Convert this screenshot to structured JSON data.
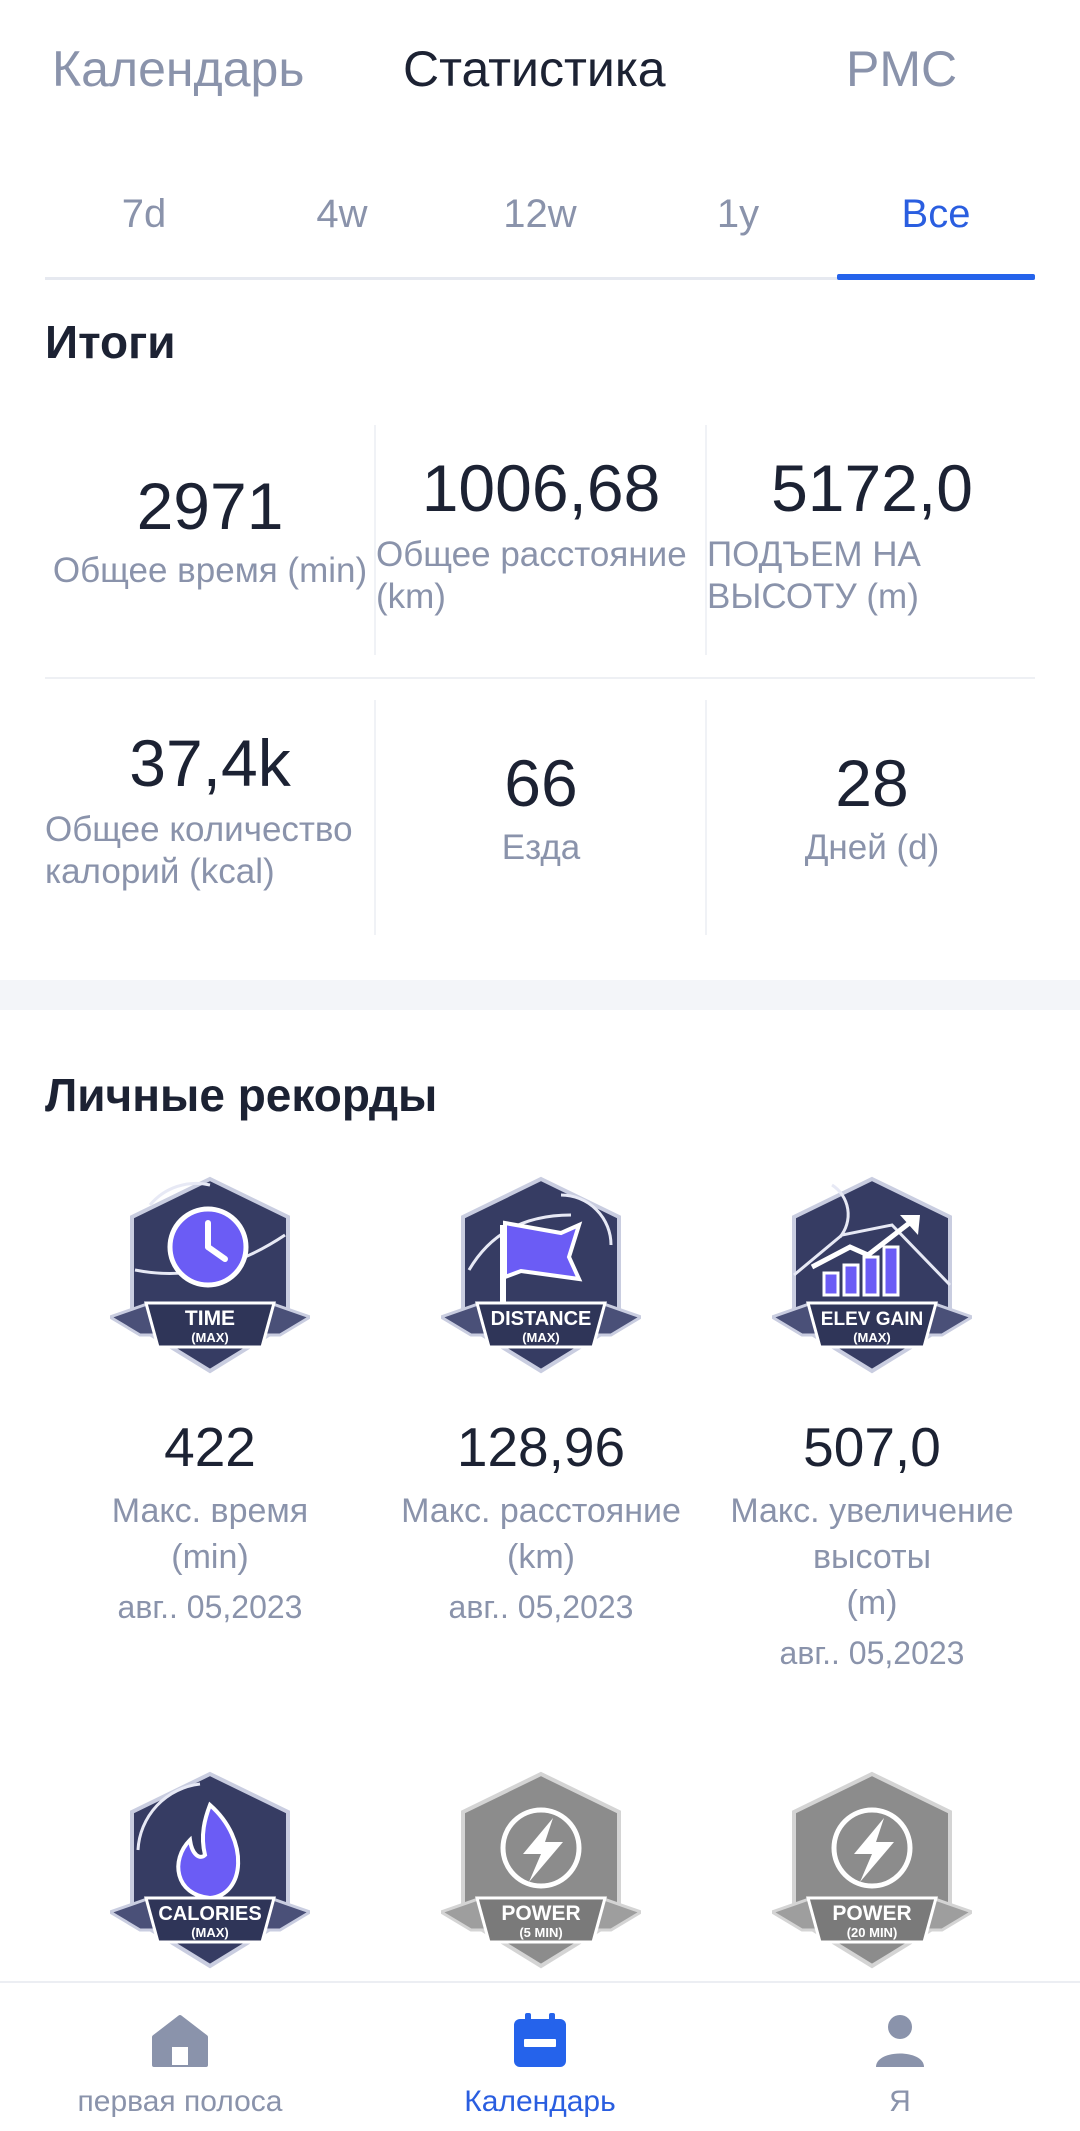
{
  "top_tabs": [
    {
      "label": "Календарь"
    },
    {
      "label": "Статистика"
    },
    {
      "label": "PMC"
    }
  ],
  "range_tabs": [
    {
      "label": "7d"
    },
    {
      "label": "4w"
    },
    {
      "label": "12w"
    },
    {
      "label": "1y"
    },
    {
      "label": "Все"
    }
  ],
  "summary": {
    "title": "Итоги",
    "stats": [
      {
        "value": "2971",
        "label": "Общее время (min)"
      },
      {
        "value": "1006,68",
        "label": "Общее расстояние (km)"
      },
      {
        "value": "5172,0",
        "label": "ПОДЪЕМ НА ВЫСОТУ (m)"
      },
      {
        "value": "37,4k",
        "label": "Общее количество калорий (kcal)"
      },
      {
        "value": "66",
        "label": "Езда"
      },
      {
        "value": "28",
        "label": "Дней (d)"
      }
    ]
  },
  "records": {
    "title": "Личные рекорды",
    "items": [
      {
        "badge_title": "TIME",
        "badge_sub": "(MAX)",
        "icon": "clock-icon",
        "value": "422",
        "label_line1": "Макс. время",
        "label_line2": "(min)",
        "date": "авг.. 05,2023"
      },
      {
        "badge_title": "DISTANCE",
        "badge_sub": "(MAX)",
        "icon": "flag-icon",
        "value": "128,96",
        "label_line1": "Макс. расстояние",
        "label_line2": "(km)",
        "date": "авг.. 05,2023"
      },
      {
        "badge_title": "ELEV GAIN",
        "badge_sub": "(MAX)",
        "icon": "elevation-chart-icon",
        "value": "507,0",
        "label_line1": "Макс. увеличение",
        "label_line2": "высоты",
        "label_line3": "(m)",
        "date": "авг.. 05,2023"
      },
      {
        "badge_title": "CALORIES",
        "badge_sub": "(MAX)",
        "icon": "flame-icon"
      },
      {
        "badge_title": "POWER",
        "badge_sub": "(5 MIN)",
        "icon": "lightning-icon"
      },
      {
        "badge_title": "POWER",
        "badge_sub": "(20 MIN)",
        "icon": "lightning-icon"
      }
    ]
  },
  "bottom_nav": [
    {
      "label": "первая полоса",
      "icon": "home-icon"
    },
    {
      "label": "Календарь",
      "icon": "calendar-icon"
    },
    {
      "label": "Я",
      "icon": "profile-icon"
    }
  ],
  "colors": {
    "accent": "#2563eb",
    "text": "#1c2233",
    "muted": "#8a93ab",
    "badge_dark": "#363c63",
    "badge_purple": "#6b5cf5",
    "badge_gray": "#8c8c8c"
  }
}
